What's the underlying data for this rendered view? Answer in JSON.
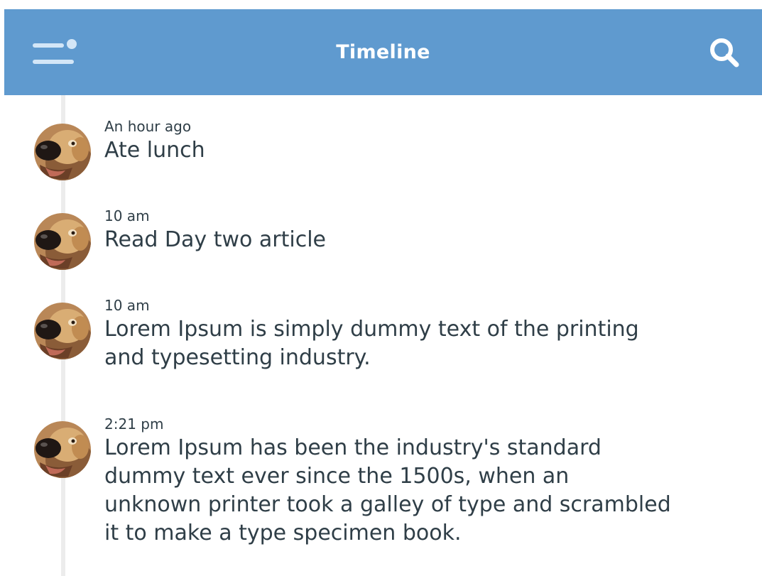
{
  "header": {
    "title": "Timeline",
    "menu_icon": "menu-icon",
    "search_icon": "search-icon",
    "background_color": "#5f9acf"
  },
  "avatar": {
    "icon": "dog-avatar"
  },
  "timeline": [
    {
      "time": "An hour ago",
      "text": "Ate lunch"
    },
    {
      "time": "10 am",
      "text": "Read Day two article"
    },
    {
      "time": "10 am",
      "text": "Lorem Ipsum is simply dummy text of the printing and typesetting industry."
    },
    {
      "time": "2:21 pm",
      "text": "Lorem Ipsum has been the industry's standard dummy text ever since the 1500s, when an unknown printer took a galley of type and scrambled it to make a type specimen book."
    }
  ]
}
